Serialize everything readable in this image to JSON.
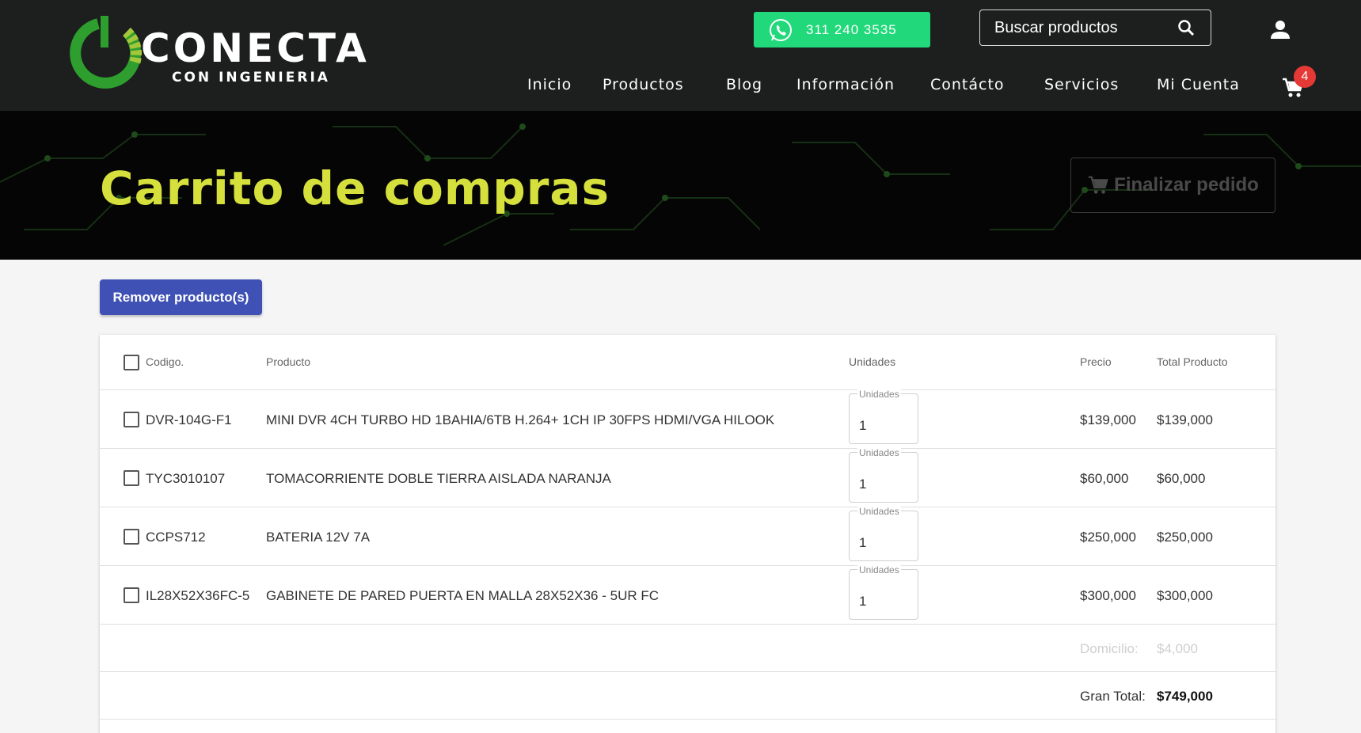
{
  "brand": {
    "logo_main": "CONECTA",
    "logo_sub": "CON INGENIERIA",
    "colors": {
      "dark_green": "#2e9e2f",
      "lime": "#a4c639",
      "yellow": "#d6e03c",
      "accent": "#3f51b5"
    }
  },
  "header": {
    "whatsapp_number": "311 240 3535",
    "search_placeholder": "Buscar productos",
    "cart_count": "4",
    "nav": [
      "Inicio",
      "Productos",
      "Blog",
      "Información",
      "Contácto",
      "Servicios",
      "Mi Cuenta"
    ]
  },
  "hero": {
    "title": "Carrito de compras",
    "finalize_label": "Finalizar pedido"
  },
  "actions": {
    "remove_label": "Remover producto(s)"
  },
  "table": {
    "headers": {
      "code": "Codigo.",
      "product": "Producto",
      "units": "Unidades",
      "price": "Precio",
      "total": "Total Producto"
    },
    "qty_label": "Unidades",
    "rows": [
      {
        "code": "DVR-104G-F1",
        "product": "MINI DVR 4CH TURBO HD 1BAHIA/6TB H.264+ 1CH IP 30FPS HDMI/VGA HILOOK",
        "units": "1",
        "price": "$139,000",
        "total": "$139,000"
      },
      {
        "code": "TYC3010107",
        "product": "TOMACORRIENTE DOBLE TIERRA AISLADA NARANJA",
        "units": "1",
        "price": "$60,000",
        "total": "$60,000"
      },
      {
        "code": "CCPS712",
        "product": "BATERIA 12V 7A",
        "units": "1",
        "price": "$250,000",
        "total": "$250,000"
      },
      {
        "code": "IL28X52X36FC-5",
        "product": "GABINETE DE PARED PUERTA EN MALLA 28X52X36 - 5UR FC",
        "units": "1",
        "price": "$300,000",
        "total": "$300,000"
      }
    ],
    "delivery_label": "Domicilio:",
    "delivery_value": "$4,000",
    "grand_total_label": "Gran Total:",
    "grand_total_value": "$749,000"
  }
}
